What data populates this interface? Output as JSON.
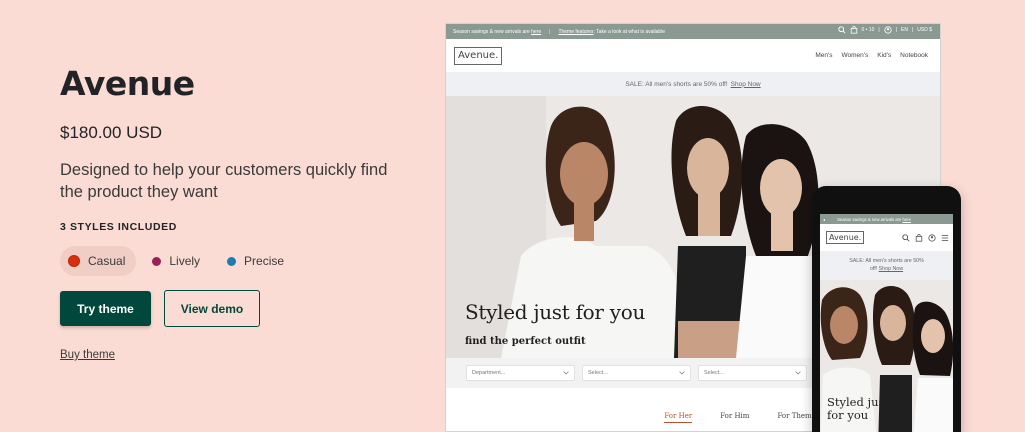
{
  "theme": {
    "name": "Avenue",
    "price": "$180.00 USD",
    "description": "Designed to help your customers quickly find the product they want",
    "styles_heading": "3 STYLES INCLUDED",
    "styles": [
      {
        "label": "Casual",
        "color": "#d8300f",
        "active": true
      },
      {
        "label": "Lively",
        "color": "#9c1f57",
        "active": false
      },
      {
        "label": "Precise",
        "color": "#1c7bb0",
        "active": false
      }
    ],
    "try_label": "Try theme",
    "demo_label": "View demo",
    "buy_label": "Buy theme"
  },
  "desktop_preview": {
    "announcement": "Season savings & new arrivals are",
    "announcement_link": "here",
    "feature_label": "Theme features",
    "feature_text": ": Take a look at what is available",
    "cart_text": "0 • 10",
    "lang": "EN",
    "currency": "USD $",
    "logo": "Avenue.",
    "nav": [
      "Men's",
      "Women's",
      "Kid's",
      "Notebook"
    ],
    "sale_text": "SALE: All men's shorts are 50% off!",
    "sale_link": "Shop Now",
    "hero_heading": "Styled just for you",
    "hero_sub": "find the perfect outfit",
    "filters": [
      "Department...",
      "Select...",
      "Select..."
    ],
    "tabs": [
      "For Her",
      "For Him",
      "For Them"
    ]
  },
  "mobile_preview": {
    "announcement": "Season savings & new arrivals are",
    "announcement_link": "here",
    "logo": "Avenue.",
    "sale_line1": "SALE: All men's shorts are 50%",
    "sale_line2": "off!",
    "sale_link": "Shop Now",
    "hero_heading_line1": "Styled just",
    "hero_heading_line2": "for you"
  },
  "colors": {
    "page_bg": "#fbdcd4",
    "primary": "#00473c",
    "announcement_bar": "#8a9a93",
    "tab_active": "#b9502c"
  }
}
